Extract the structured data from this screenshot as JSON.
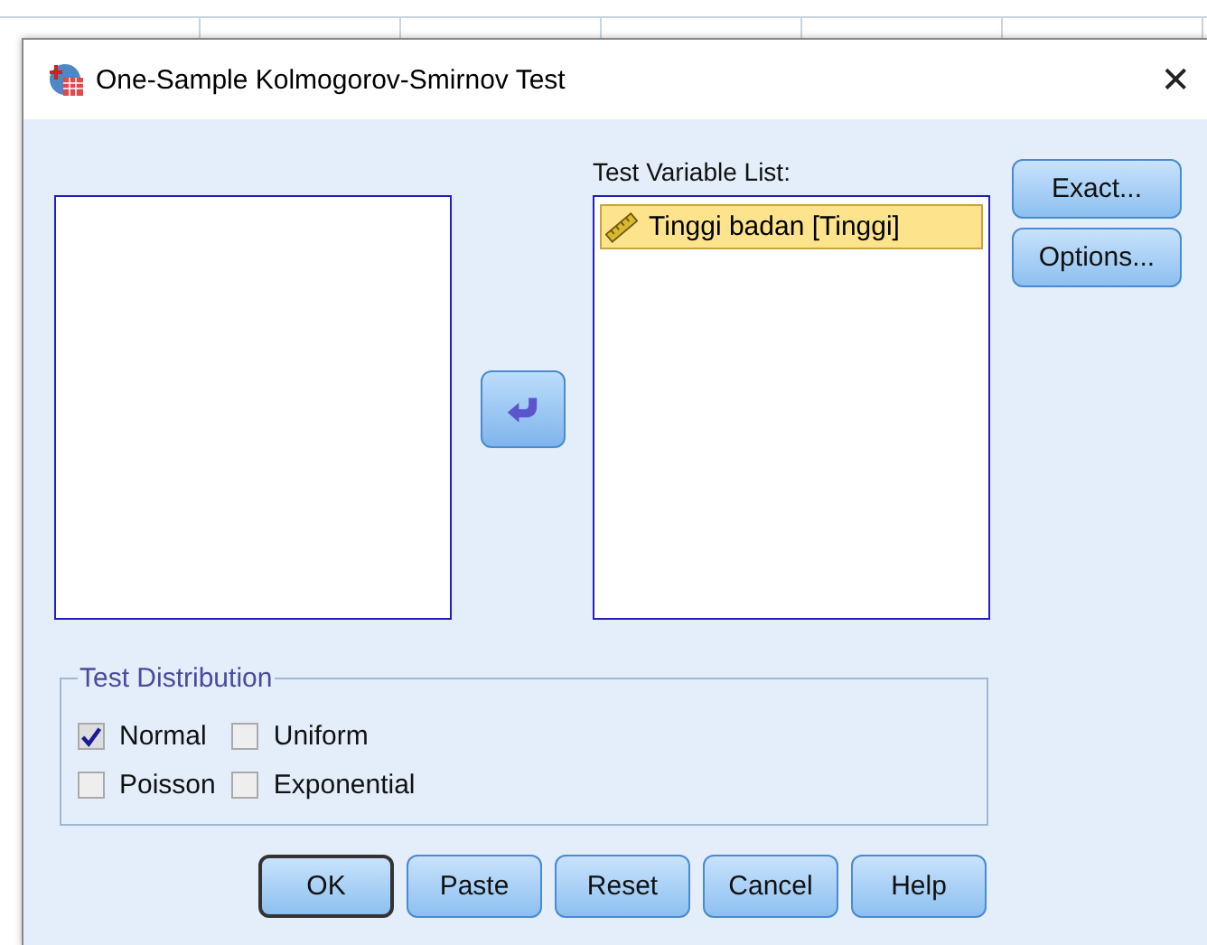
{
  "window": {
    "title": "One-Sample Kolmogorov-Smirnov Test",
    "close": "✕"
  },
  "test_variable_list": {
    "label": "Test Variable List:",
    "items": [
      {
        "label": "Tinggi badan [Tinggi]",
        "kind": "scale",
        "selected": true
      }
    ]
  },
  "side_buttons": [
    {
      "label": "Exact..."
    },
    {
      "label": "Options..."
    }
  ],
  "test_distribution": {
    "title": "Test Distribution",
    "options": [
      {
        "label": "Normal",
        "checked": true
      },
      {
        "label": "Uniform",
        "checked": false
      },
      {
        "label": "Poisson",
        "checked": false
      },
      {
        "label": "Exponential",
        "checked": false
      }
    ]
  },
  "buttons": [
    {
      "label": "OK",
      "default": true
    },
    {
      "label": "Paste",
      "default": false
    },
    {
      "label": "Reset",
      "default": false
    },
    {
      "label": "Cancel",
      "default": false
    },
    {
      "label": "Help",
      "default": false
    }
  ]
}
